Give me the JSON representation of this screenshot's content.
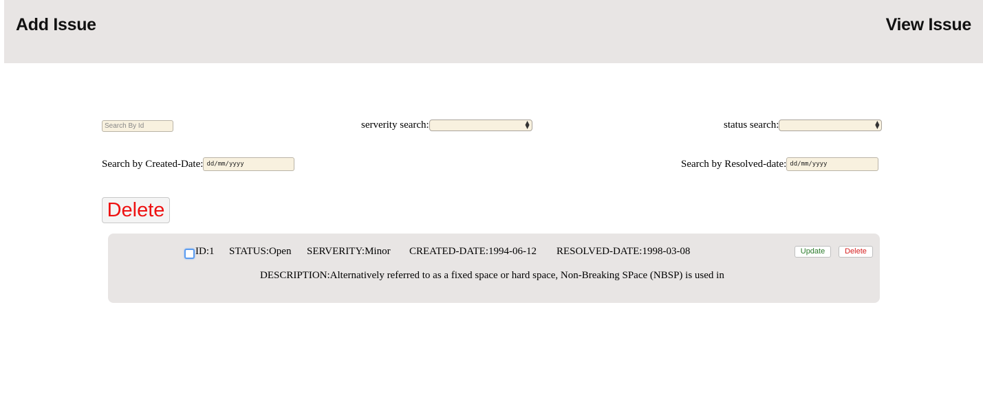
{
  "nav": {
    "add_label": "Add Issue",
    "view_label": "View Issue"
  },
  "filters": {
    "search_id_placeholder": "Search By Id",
    "severity_label": "serverity search:",
    "status_label": "status search:",
    "created_label": "Search by Created-Date:",
    "created_placeholder": "dd/mm/yyyy",
    "resolved_label": "Search by Resolved-date:",
    "resolved_placeholder": "dd/mm/yyyy"
  },
  "delete_all_label": "Delete",
  "issues": [
    {
      "id": "ID:1",
      "status": "STATUS:Open",
      "severity": "SERVERITY:Minor",
      "created": "CREATED-DATE:1994-06-12",
      "resolved": "RESOLVED-DATE:1998-03-08",
      "description": "DESCRIPTION:Alternatively referred to as a fixed space or hard space, Non-Breaking SPace (NBSP) is used in",
      "update_label": "Update",
      "delete_label": "Delete"
    }
  ],
  "colors": {
    "header_bg": "#e8e5e4",
    "input_bg": "#f8f1df",
    "delete_red": "#ee1111",
    "update_green": "#2a7a2a"
  }
}
